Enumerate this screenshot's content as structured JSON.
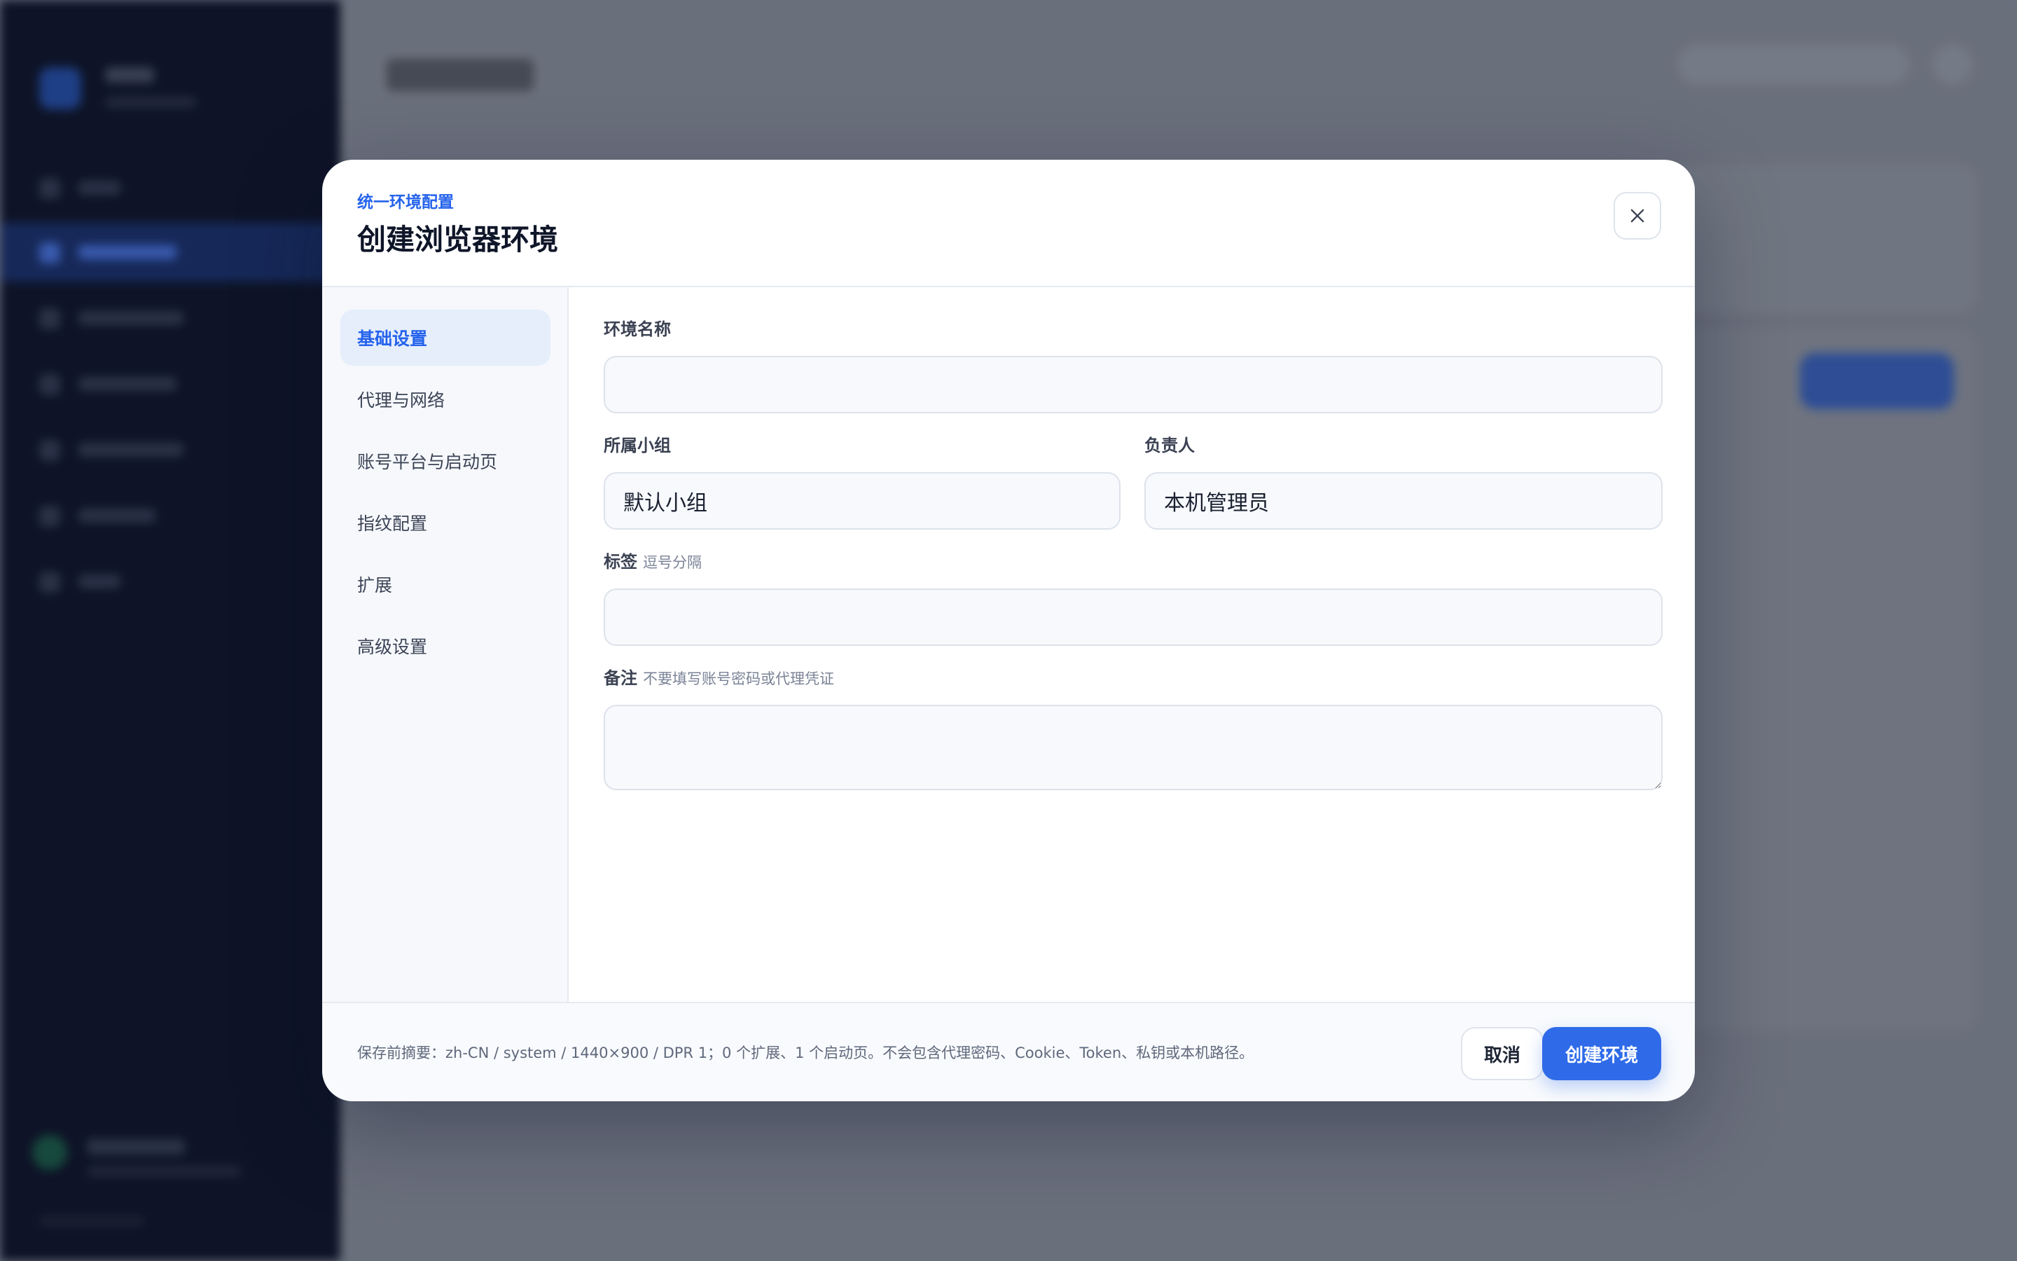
{
  "dialog": {
    "kicker": "统一环境配置",
    "title": "创建浏览器环境",
    "close_icon": "close-icon"
  },
  "nav": {
    "items": [
      {
        "label": "基础设置",
        "active": true
      },
      {
        "label": "代理与网络",
        "active": false
      },
      {
        "label": "账号平台与启动页",
        "active": false
      },
      {
        "label": "指纹配置",
        "active": false
      },
      {
        "label": "扩展",
        "active": false
      },
      {
        "label": "高级设置",
        "active": false
      }
    ]
  },
  "form": {
    "name_label": "环境名称",
    "name_value": "",
    "group_label": "所属小组",
    "group_value": "默认小组",
    "owner_label": "负责人",
    "owner_value": "本机管理员",
    "tags_label": "标签",
    "tags_hint": "逗号分隔",
    "tags_value": "",
    "notes_label": "备注",
    "notes_hint": "不要填写账号密码或代理凭证",
    "notes_value": ""
  },
  "footer": {
    "summary": "保存前摘要：zh-CN / system / 1440×900 / DPR 1；0 个扩展、1 个启动页。不会包含代理密码、Cookie、Token、私钥或本机路径。",
    "cancel_label": "取消",
    "create_label": "创建环境"
  },
  "colors": {
    "accent": "#2563eb",
    "primary_button": "#2f6be8",
    "sidebar_bg": "#0b1024"
  }
}
